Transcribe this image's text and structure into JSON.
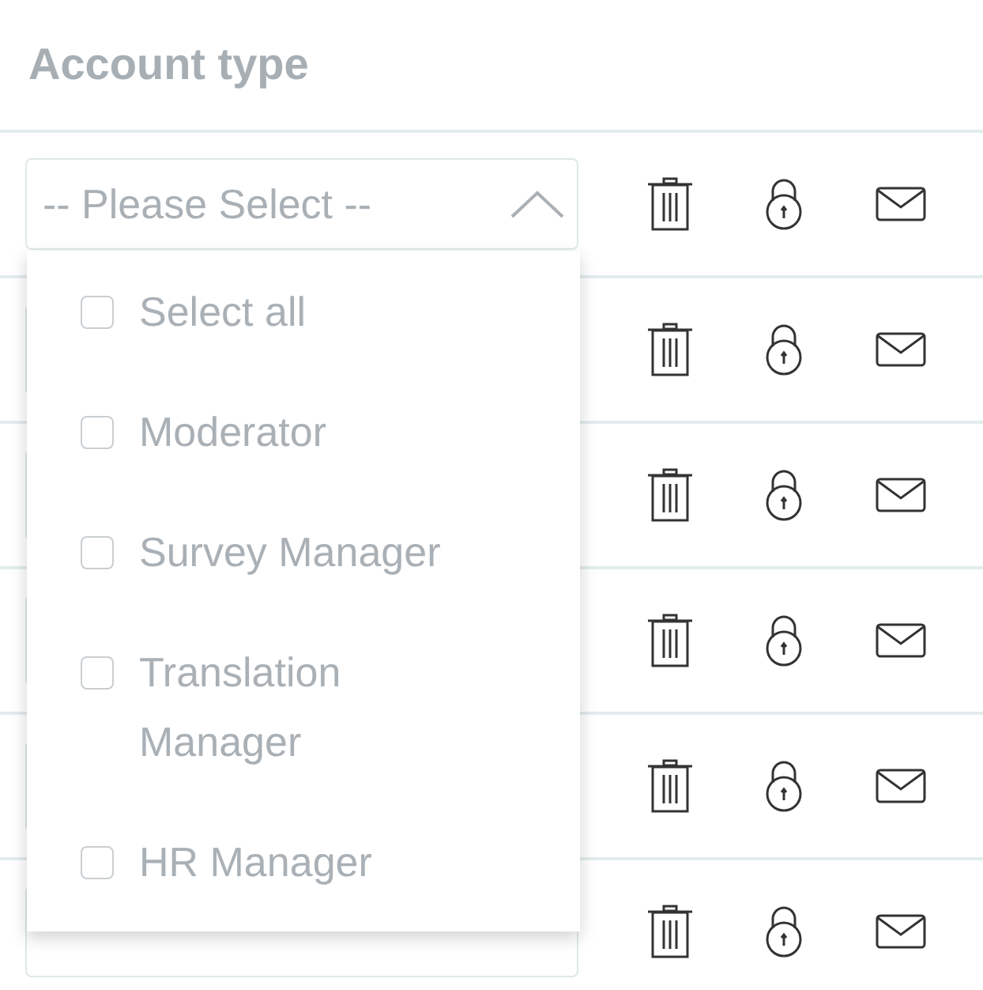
{
  "header": {
    "title": "Account type"
  },
  "rows": [
    {
      "select": {
        "placeholder": "-- Please Select --",
        "expanded": true
      }
    },
    {
      "select": {
        "expanded": false
      }
    },
    {
      "select": {
        "expanded": false
      }
    },
    {
      "select": {
        "expanded": false
      }
    },
    {
      "select": {
        "expanded": false
      }
    },
    {
      "select": {
        "expanded": false
      }
    }
  ],
  "dropdown": {
    "options": [
      {
        "label": "Select all",
        "checked": false
      },
      {
        "label": "Moderator",
        "checked": false
      },
      {
        "label": "Survey Manager",
        "checked": false
      },
      {
        "label": "Translation Manager",
        "checked": false
      },
      {
        "label": "HR Manager",
        "checked": false
      }
    ]
  }
}
